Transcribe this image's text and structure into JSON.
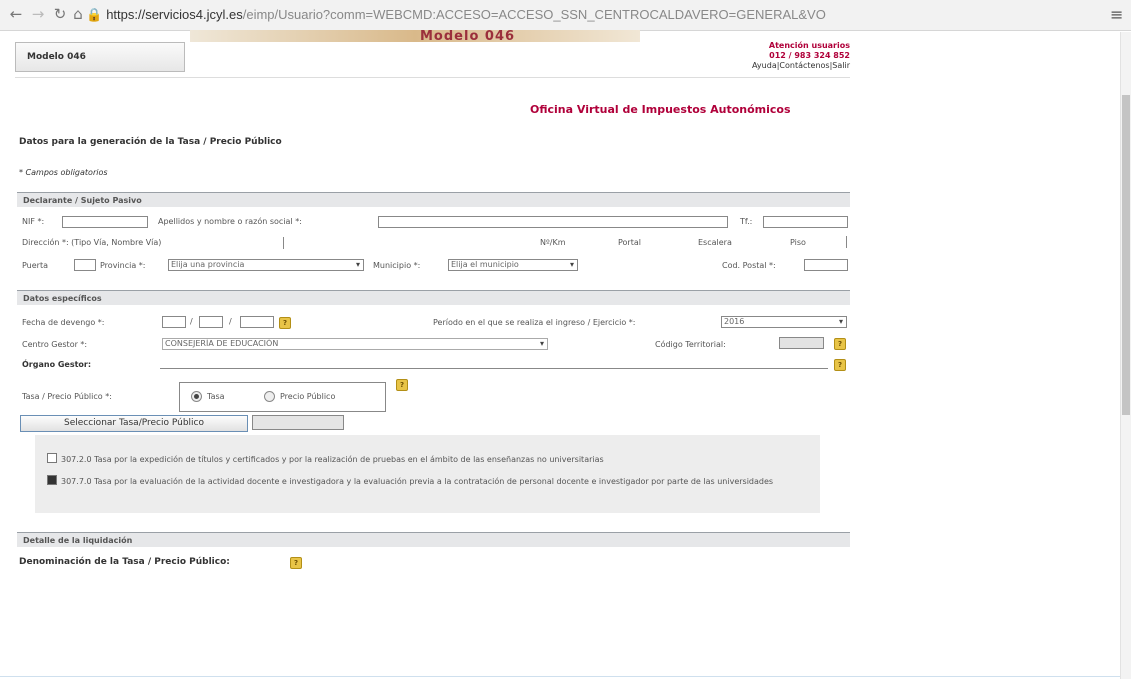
{
  "browser": {
    "url_host": "https://servicios4.jcyl.es",
    "url_path": "/eimp/Usuario?comm=WEBCMD:ACCESO=ACCESO_SSN_CENTROCALDAVERO=GENERAL&VO",
    "back_icon": "arrow-left",
    "forward_icon": "arrow-right",
    "reload_icon": "reload",
    "home_icon": "home",
    "lock_icon": "lock",
    "menu_icon": "hamburger"
  },
  "header": {
    "banner_text": "Modelo 046",
    "model_label": "Modelo 046",
    "atencion": "Atención usuarios",
    "phone": "012 / 983 324 852",
    "links": "Ayuda|Contáctenos|Salir",
    "oficina": "Oficina Virtual de Impuestos Autonómicos"
  },
  "form": {
    "title": "Datos para la generación de la Tasa / Precio Público",
    "required_note": "* Campos obligatorios",
    "declarante": {
      "section": "Declarante / Sujeto Pasivo",
      "nif_label": "NIF *:",
      "apellidos_label": "Apellidos y nombre o razón social *:",
      "tel_label": "Tf.:",
      "direccion_label": "Dirección *: (Tipo Vía, Nombre Vía)",
      "num_label": "Nº/Km",
      "portal_label": "Portal",
      "escalera_label": "Escalera",
      "piso_label": "Piso",
      "puerta_label": "Puerta",
      "provincia_label": "Provincia *:",
      "provincia_value": "Elija una provincia",
      "municipio_label": "Municipio *:",
      "municipio_value": "Elija el municipio",
      "cp_label": "Cod. Postal *:"
    },
    "especificos": {
      "section": "Datos específicos",
      "fecha_label": "Fecha de devengo *:",
      "periodo_label": "Período en el que se realiza el ingreso / Ejercicio *:",
      "periodo_value": "2016",
      "centro_label": "Centro Gestor *:",
      "centro_value": "CONSEJERÍA DE EDUCACIÓN",
      "codigo_label": "Código Territorial:",
      "organo_label": "Órgano Gestor:",
      "tasa_label": "Tasa / Precio Público *:",
      "opt_tasa": "Tasa",
      "opt_precio": "Precio Público",
      "select_button": "Seleccionar Tasa/Precio Público"
    },
    "tasas": [
      "307.2.0 Tasa por la expedición de títulos y certificados y por la realización de pruebas en el ámbito de las enseñanzas no universitarias",
      "307.7.0 Tasa por la evaluación de la actividad docente e investigadora y la evaluación previa a la contratación de personal docente e investigador por parte de las universidades"
    ],
    "liquidacion": {
      "section": "Detalle de la liquidación",
      "denom_label": "Denominación de la Tasa / Precio Público:"
    }
  }
}
